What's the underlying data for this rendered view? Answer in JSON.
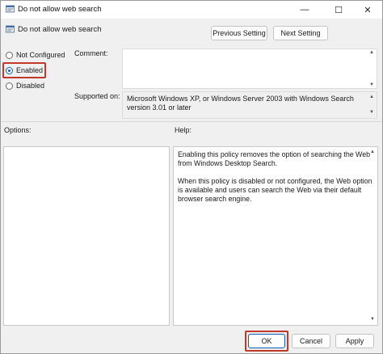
{
  "window": {
    "title": "Do not allow web search",
    "controls": {
      "minimize": "—",
      "maximize": "☐",
      "close": "✕"
    }
  },
  "header": {
    "title": "Do not allow web search",
    "previous_button": "Previous Setting",
    "next_button": "Next Setting"
  },
  "state": {
    "options": [
      {
        "label": "Not Configured",
        "checked": false
      },
      {
        "label": "Enabled",
        "checked": true
      },
      {
        "label": "Disabled",
        "checked": false
      }
    ]
  },
  "comment": {
    "label": "Comment:",
    "value": ""
  },
  "supported": {
    "label": "Supported on:",
    "value": "Microsoft Windows XP, or Windows Server 2003 with Windows Search version 3.01 or later"
  },
  "options_panel": {
    "label": "Options:"
  },
  "help_panel": {
    "label": "Help:",
    "paragraphs": [
      "Enabling this policy removes the option of searching the Web from Windows Desktop Search.",
      "When this policy is disabled or not configured, the Web option is available and users can search the Web via their default browser search engine."
    ]
  },
  "footer": {
    "ok": "OK",
    "cancel": "Cancel",
    "apply": "Apply"
  },
  "colors": {
    "accent": "#0a5fb4",
    "highlight": "#c0392b"
  }
}
